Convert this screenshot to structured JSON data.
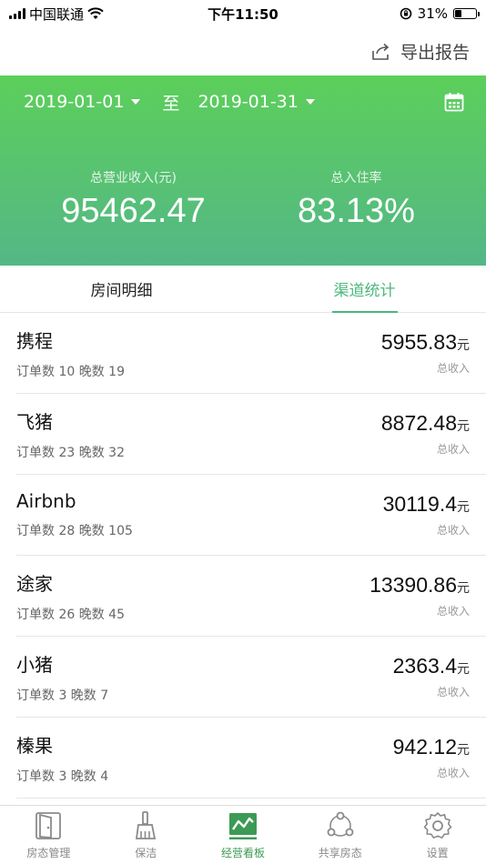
{
  "status_bar": {
    "carrier": "中国联通",
    "time": "下午11:50",
    "battery_text": "31%",
    "battery_level": 0.31
  },
  "nav": {
    "export_label": "导出报告"
  },
  "header": {
    "start_date": "2019-01-01",
    "to_label": "至",
    "end_date": "2019-01-31",
    "revenue_label": "总营业收入(元)",
    "revenue_value": "95462.47",
    "occupancy_label": "总入住率",
    "occupancy_value": "83.13%"
  },
  "tabs": [
    {
      "label": "房间明细",
      "active": false
    },
    {
      "label": "渠道统计",
      "active": true
    }
  ],
  "channels": [
    {
      "name": "携程",
      "meta": "订单数 10 晚数 19",
      "amount": "5955.83",
      "unit": "元",
      "sub": "总收入"
    },
    {
      "name": "飞猪",
      "meta": "订单数 23 晚数 32",
      "amount": "8872.48",
      "unit": "元",
      "sub": "总收入"
    },
    {
      "name": "Airbnb",
      "meta": "订单数 28 晚数 105",
      "amount": "30119.4",
      "unit": "元",
      "sub": "总收入"
    },
    {
      "name": "途家",
      "meta": "订单数 26 晚数 45",
      "amount": "13390.86",
      "unit": "元",
      "sub": "总收入"
    },
    {
      "name": "小猪",
      "meta": "订单数 3 晚数 7",
      "amount": "2363.4",
      "unit": "元",
      "sub": "总收入"
    },
    {
      "name": "榛果",
      "meta": "订单数 3 晚数 4",
      "amount": "942.12",
      "unit": "元",
      "sub": "总收入"
    }
  ],
  "tab_bar": [
    {
      "label": "房态管理",
      "icon": "door-icon",
      "active": false
    },
    {
      "label": "保洁",
      "icon": "broom-icon",
      "active": false
    },
    {
      "label": "经营看板",
      "icon": "chart-board-icon",
      "active": true
    },
    {
      "label": "共享房态",
      "icon": "share-icon",
      "active": false
    },
    {
      "label": "设置",
      "icon": "gear-icon",
      "active": false
    }
  ],
  "colors": {
    "accent": "#4cb87e",
    "header_gradient_top": "#5ccf5a",
    "header_gradient_bottom": "#54b787",
    "tab_bar_active": "#3c9a55"
  }
}
